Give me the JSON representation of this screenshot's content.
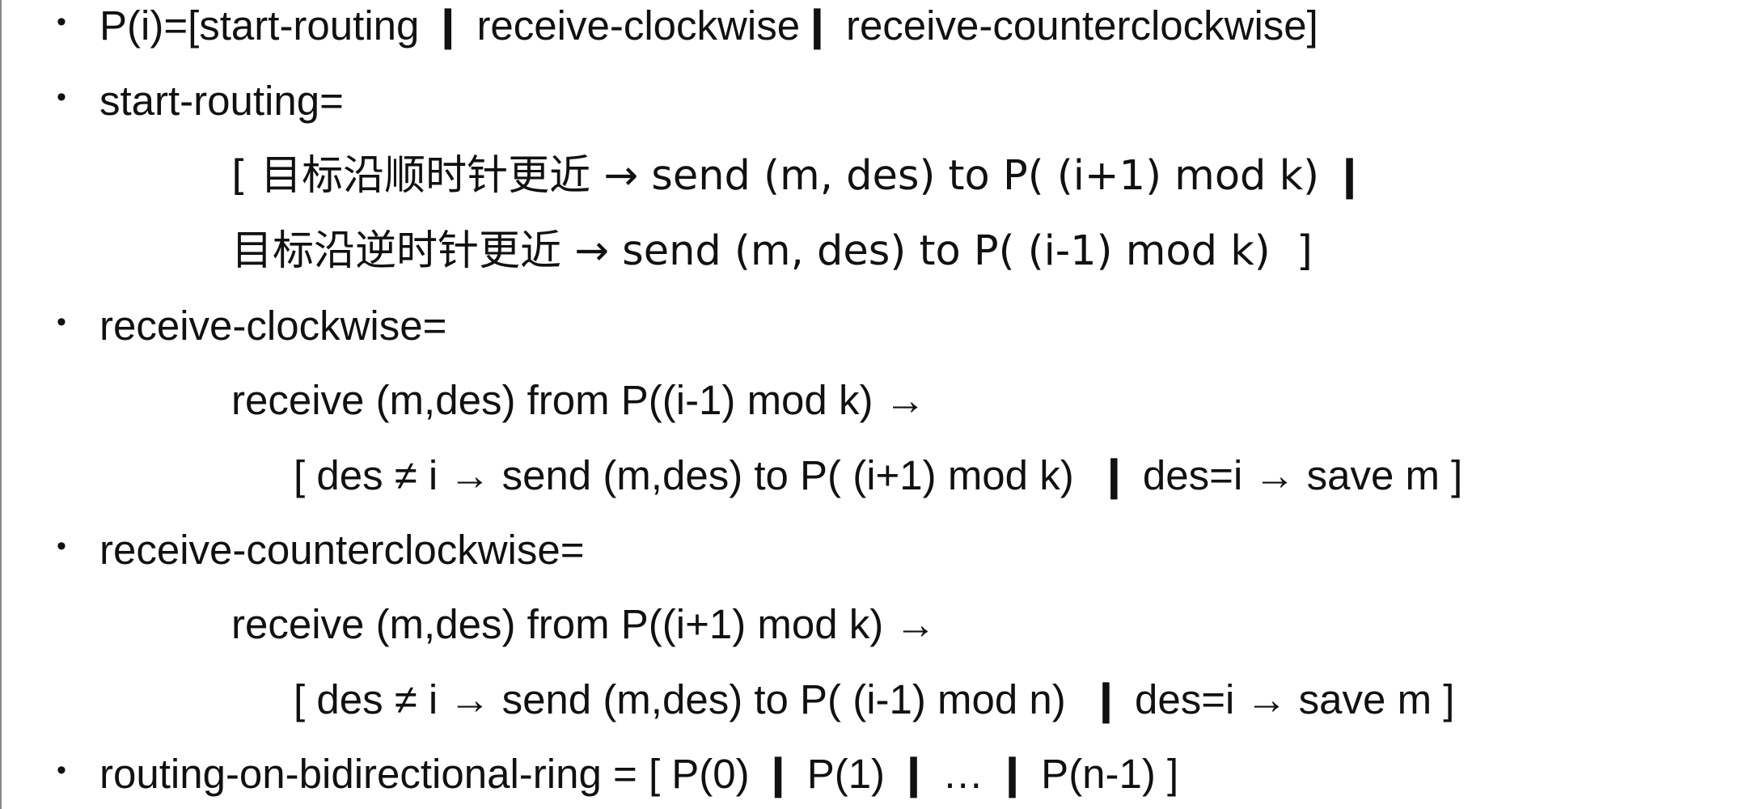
{
  "lines": [
    {
      "bullet": "•",
      "text": "P(i)=[start-routing ❙ receive-clockwise❙ receive-counterclockwise]"
    },
    {
      "bullet": "•",
      "text": "start-routing="
    },
    {
      "bullet": "",
      "text": "[ 目标沿顺时针更近 → send (m, des) to P( (i+1) mod k) ❙"
    },
    {
      "bullet": "",
      "text": "目标沿逆时针更近 → send (m, des) to P( (i-1) mod k)  ]"
    },
    {
      "bullet": "•",
      "text": "receive-clockwise="
    },
    {
      "bullet": "",
      "text": "receive (m,des) from P((i-1) mod k) →"
    },
    {
      "bullet": "",
      "text": "[ des ≠ i → send (m,des) to P( (i+1) mod k)  ❙ des=i → save m ]"
    },
    {
      "bullet": "•",
      "text": "receive-counterclockwise="
    },
    {
      "bullet": "",
      "text": "receive (m,des) from P((i+1) mod k) →"
    },
    {
      "bullet": "",
      "text": "[ des ≠ i → send (m,des) to P( (i-1) mod n)  ❙ des=i → save m ]"
    },
    {
      "bullet": "•",
      "text": "routing-on-bidirectional-ring = [ P(0) ❙ P(1) ❙ … ❙ P(n-1) ]"
    }
  ]
}
